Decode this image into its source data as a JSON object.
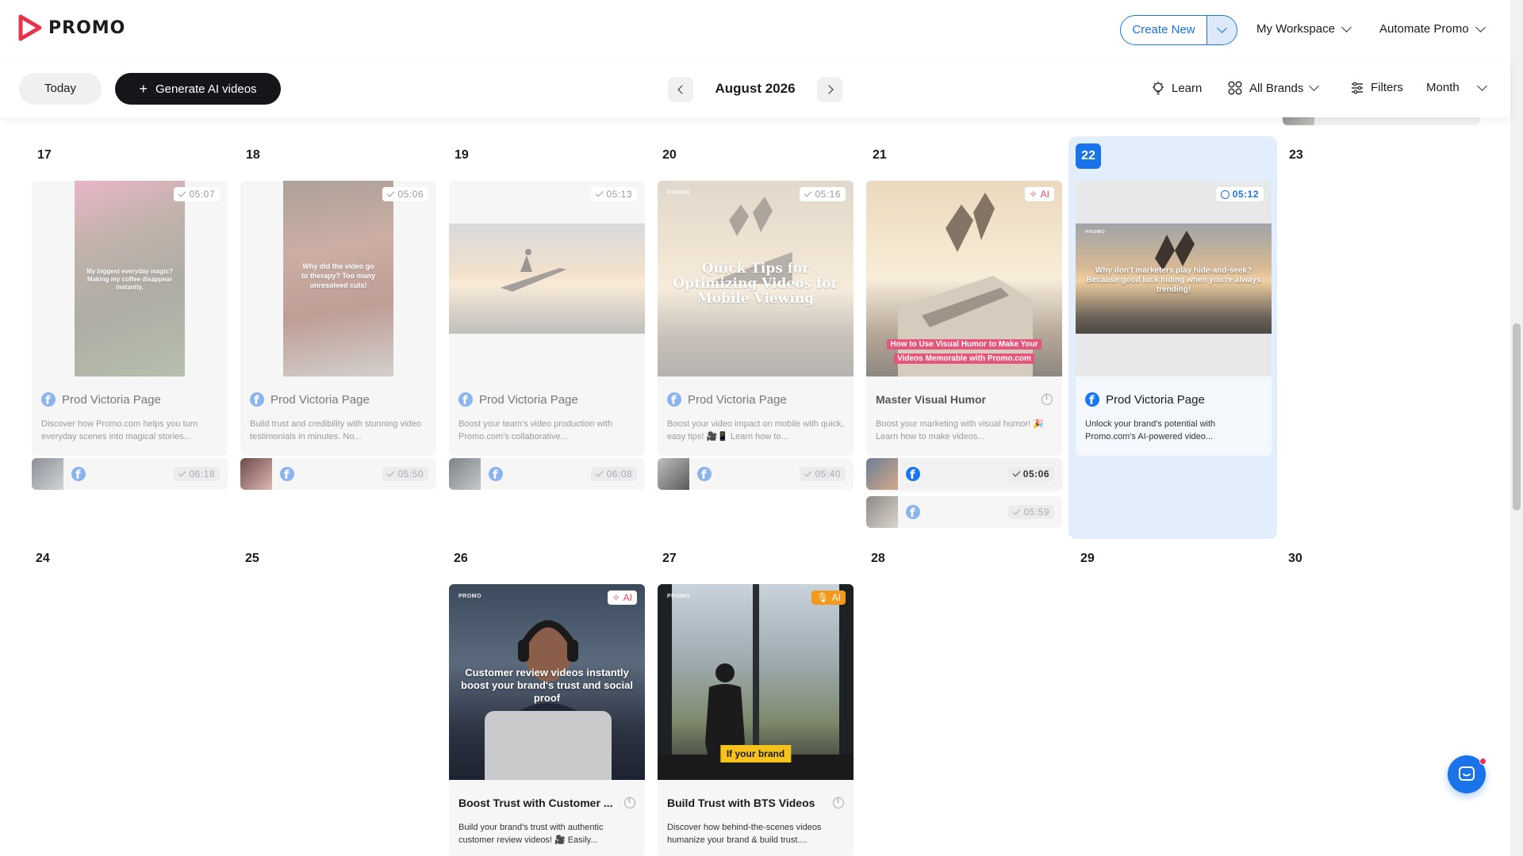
{
  "app": {
    "name": "PROMO"
  },
  "header": {
    "create_new": "Create New",
    "workspace": "My Workspace",
    "automate": "Automate Promo"
  },
  "toolbar": {
    "today": "Today",
    "generate": "Generate AI videos",
    "month_title": "August 2026",
    "learn": "Learn",
    "brands": "All Brands",
    "filters": "Filters",
    "view": "Month"
  },
  "days": {
    "d17": "17",
    "d18": "18",
    "d19": "19",
    "d20": "20",
    "d21": "21",
    "d22": "22",
    "d23": "23",
    "d24": "24",
    "d25": "25",
    "d26": "26",
    "d27": "27",
    "d28": "28",
    "d29": "29",
    "d30": "30"
  },
  "cards": {
    "c17": {
      "time": "05:07",
      "title": "Prod Victoria Page",
      "desc": "Discover how Promo.com helps you turn everyday scenes into magical stories...",
      "overlay": "My biggest everyday magic? Making my coffee disappear instantly."
    },
    "c18": {
      "time": "05:06",
      "title": "Prod Victoria Page",
      "desc": "Build trust and credibility with stunning video testimonials in minutes. No...",
      "overlay": "Why did the video go to therapy? Too many unresolved cuts!"
    },
    "c19": {
      "time": "05:13",
      "title": "Prod Victoria Page",
      "desc": "Boost your team's video production with Promo.com's collaborative..."
    },
    "c20": {
      "time": "05:16",
      "title": "Prod Victoria Page",
      "desc": "Boost your video impact on mobile with quick, easy tips! 🎥📱 Learn how to...",
      "overlay": "Quick Tips for Optimizing Videos for Mobile Viewing",
      "logo": "PROMO"
    },
    "c21": {
      "badge": "AI",
      "title": "Master Visual Humor",
      "desc": "Boost your marketing with visual humor! 🎉 Learn how to make videos...",
      "overlay": "How to Use Visual Humor to Make Your Videos Memorable with Promo.com"
    },
    "c22": {
      "time": "05:12",
      "title": "Prod Victoria Page",
      "desc": "Unlock your brand's potential with Promo.com's AI-powered video...",
      "overlay": "Why don't marketers play hide-and-seek? Because good luck hiding when you're always trending!"
    },
    "c26": {
      "badge": "AI",
      "title": "Boost Trust with Customer ...",
      "desc": "Build your brand's trust with authentic customer review videos! 🎥 Easily...",
      "overlay": "Customer review videos instantly boost your brand's trust and social proof",
      "logo": "PROMO"
    },
    "c27": {
      "badge": "AI",
      "title": "Build Trust with BTS Videos",
      "desc": "Discover how behind-the-scenes videos humanize your brand & build trust....",
      "overlay": "If your brand",
      "logo": "PROMO"
    }
  },
  "minis": {
    "m17": "06:18",
    "m18": "05:50",
    "m19": "06:08",
    "m20": "05:40",
    "m21a": "05:06",
    "m21b": "05:59"
  },
  "colors": {
    "accent": "#1a73e8",
    "brand": "#e8334a",
    "dark_button": "#15161a",
    "today_bg": "#e2eefc"
  }
}
